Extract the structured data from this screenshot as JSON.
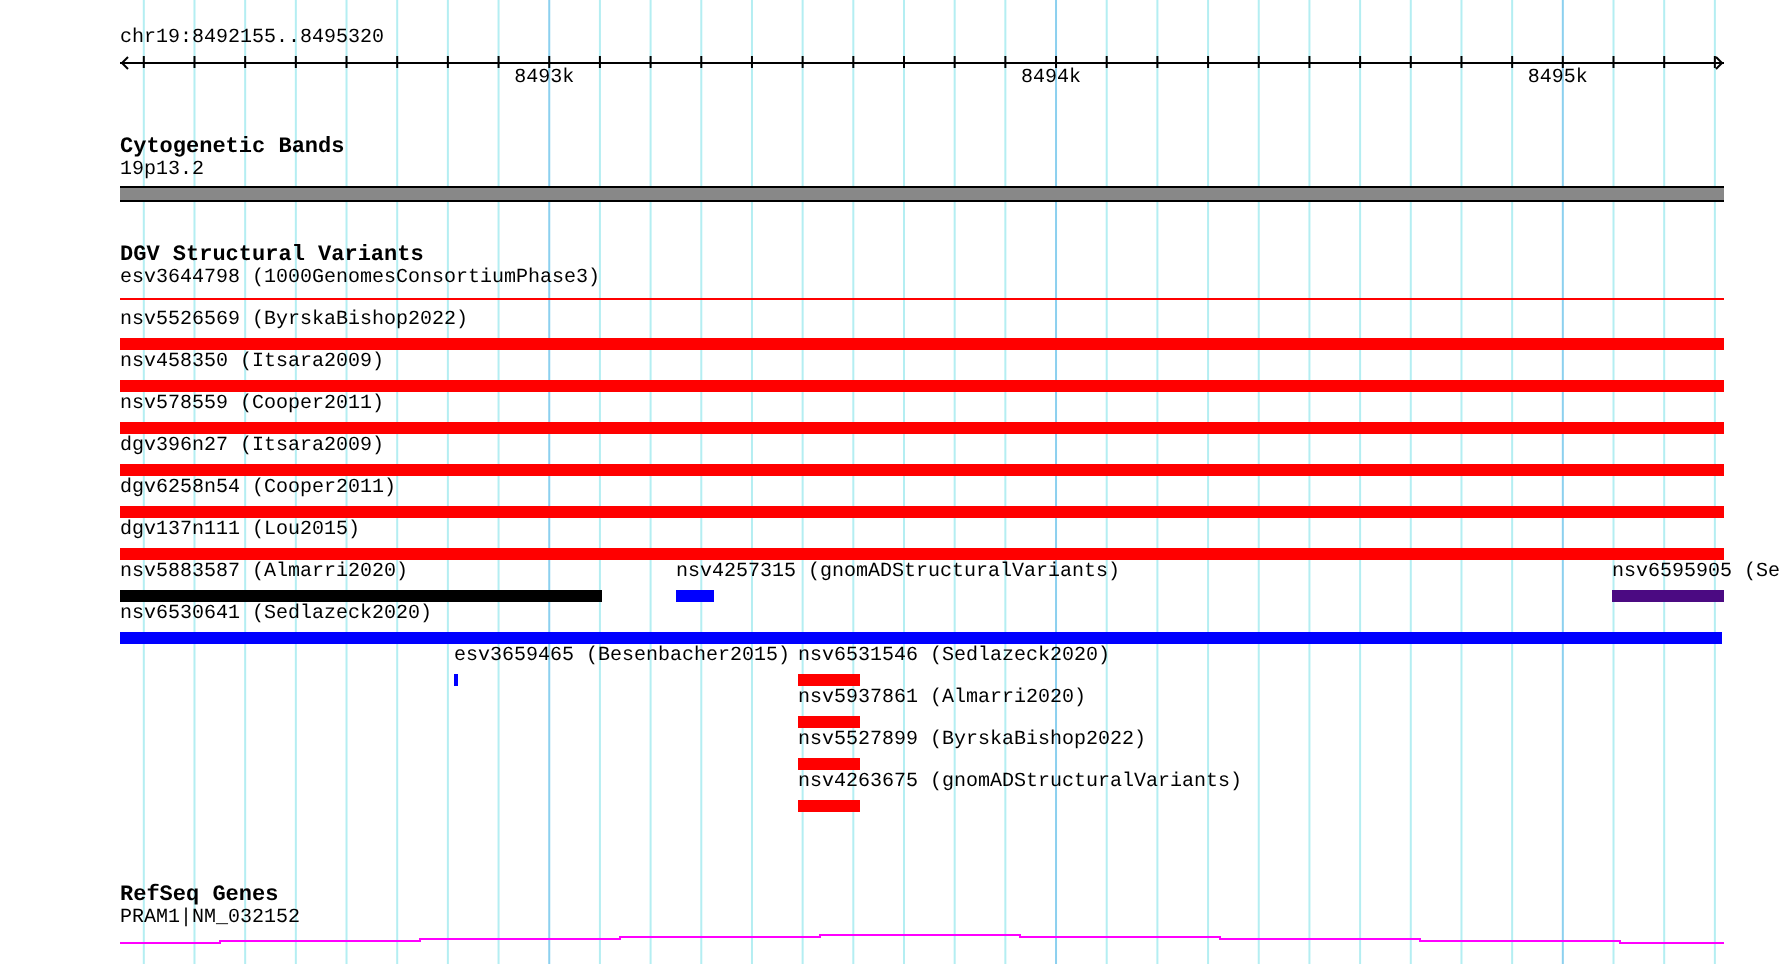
{
  "ruler": {
    "position": "chr19:8492155..8495320",
    "ticks": [
      "8493k",
      "8494k",
      "8495k"
    ]
  },
  "cytogenetic_bands": {
    "title": "Cytogenetic Bands",
    "band": {
      "name": "19p13.2",
      "color": "#888888"
    }
  },
  "dgv_structural_variants": {
    "title": "DGV Structural Variants",
    "rows": [
      [
        {
          "label": "esv3644798 (1000GenomesConsortiumPhase3)",
          "kind": "line",
          "color": "#ff0000"
        }
      ],
      [
        {
          "label": "nsv5526569 (ByrskaBishop2022)",
          "kind": "bar",
          "color": "#ff0000"
        }
      ],
      [
        {
          "label": "nsv458350 (Itsara2009)",
          "kind": "bar",
          "color": "#ff0000"
        }
      ],
      [
        {
          "label": "nsv578559 (Cooper2011)",
          "kind": "bar",
          "color": "#ff0000"
        }
      ],
      [
        {
          "label": "dgv396n27 (Itsara2009)",
          "kind": "bar",
          "color": "#ff0000"
        }
      ],
      [
        {
          "label": "dgv6258n54 (Cooper2011)",
          "kind": "bar",
          "color": "#ff0000"
        }
      ],
      [
        {
          "label": "dgv137n111 (Lou2015)",
          "kind": "bar",
          "color": "#ff0000"
        }
      ],
      [
        {
          "label": "nsv5883587 (Almarri2020)",
          "kind": "bar",
          "color": "#000000"
        },
        {
          "label": "nsv4257315 (gnomADStructuralVariants)",
          "kind": "bar",
          "color": "#0000ff"
        },
        {
          "label": "nsv6595905 (Se",
          "kind": "bar",
          "color": "#4b0a82"
        }
      ],
      [
        {
          "label": "nsv6530641 (Sedlazeck2020)",
          "kind": "bar",
          "color": "#0000ff"
        }
      ],
      [
        {
          "label": "esv3659465 (Besenbacher2015)",
          "kind": "bar",
          "color": "#0000ff"
        },
        {
          "label": "nsv6531546 (Sedlazeck2020)",
          "kind": "bar",
          "color": "#ff0000"
        }
      ],
      [
        {
          "label": "nsv5937861 (Almarri2020)",
          "kind": "bar",
          "color": "#ff0000"
        }
      ],
      [
        {
          "label": "nsv5527899 (ByrskaBishop2022)",
          "kind": "bar",
          "color": "#ff0000"
        }
      ],
      [
        {
          "label": "nsv4263675 (gnomADStructuralVariants)",
          "kind": "bar",
          "color": "#ff0000"
        }
      ]
    ]
  },
  "refseq_genes": {
    "title": "RefSeq Genes",
    "gene": {
      "label": "PRAM1|NM_032152"
    }
  }
}
